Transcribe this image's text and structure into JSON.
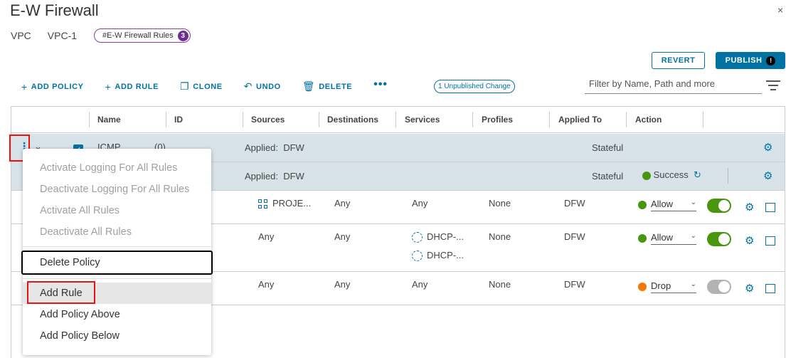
{
  "header": {
    "title": "E-W Firewall",
    "close_glyph": "×"
  },
  "breadcrumb": {
    "item1": "VPC",
    "item2": "VPC-1",
    "tag_label": "#E-W Firewall Rules",
    "tag_count": "3"
  },
  "actions": {
    "revert": "REVERT",
    "publish": "PUBLISH",
    "publish_badge": "!"
  },
  "toolbar": {
    "add_policy": "ADD POLICY",
    "add_rule": "ADD RULE",
    "clone": "CLONE",
    "undo": "UNDO",
    "delete": "DELETE",
    "more": "•••",
    "unpublished": "1 Unpublished Change",
    "filter_placeholder": "Filter by Name, Path and more"
  },
  "columns": [
    "Name",
    "ID",
    "Sources",
    "Destinations",
    "Services",
    "Profiles",
    "Applied To",
    "Action"
  ],
  "rows": [
    {
      "name": "ICMP",
      "id": "(0)",
      "sources_prefix": "Applied:",
      "sources": "DFW",
      "applied_to": "Stateful"
    },
    {
      "sources_prefix": "Applied:",
      "sources": "DFW",
      "applied_to": "Stateful",
      "status": "Success"
    },
    {
      "sources": "PROJE...",
      "destinations": "Any",
      "services": "Any",
      "profiles": "None",
      "applied_to": "DFW",
      "action": "Allow"
    },
    {
      "sources": "Any",
      "destinations": "Any",
      "services1": "DHCP-...",
      "services2": "DHCP-...",
      "profiles": "None",
      "applied_to": "DFW",
      "action": "Allow"
    },
    {
      "sources": "Any",
      "destinations": "Any",
      "services": "Any",
      "profiles": "None",
      "applied_to": "DFW",
      "action": "Drop"
    }
  ],
  "context_menu": {
    "items": [
      {
        "label": "Activate Logging For All Rules",
        "disabled": true
      },
      {
        "label": "Deactivate Logging For All Rules",
        "disabled": true
      },
      {
        "label": "Activate All Rules",
        "disabled": true
      },
      {
        "label": "Deactivate All Rules",
        "disabled": true
      },
      {
        "label": "Delete Policy",
        "disabled": false
      },
      {
        "label": "Add Rule",
        "disabled": false
      },
      {
        "label": "Add Policy Above",
        "disabled": false
      },
      {
        "label": "Add Policy Below",
        "disabled": false
      }
    ]
  },
  "colors": {
    "accent": "#0072a3",
    "allow": "#48960c",
    "drop": "#f57600",
    "tag": "#6b2e94",
    "highlight_box": "#ee1111"
  }
}
